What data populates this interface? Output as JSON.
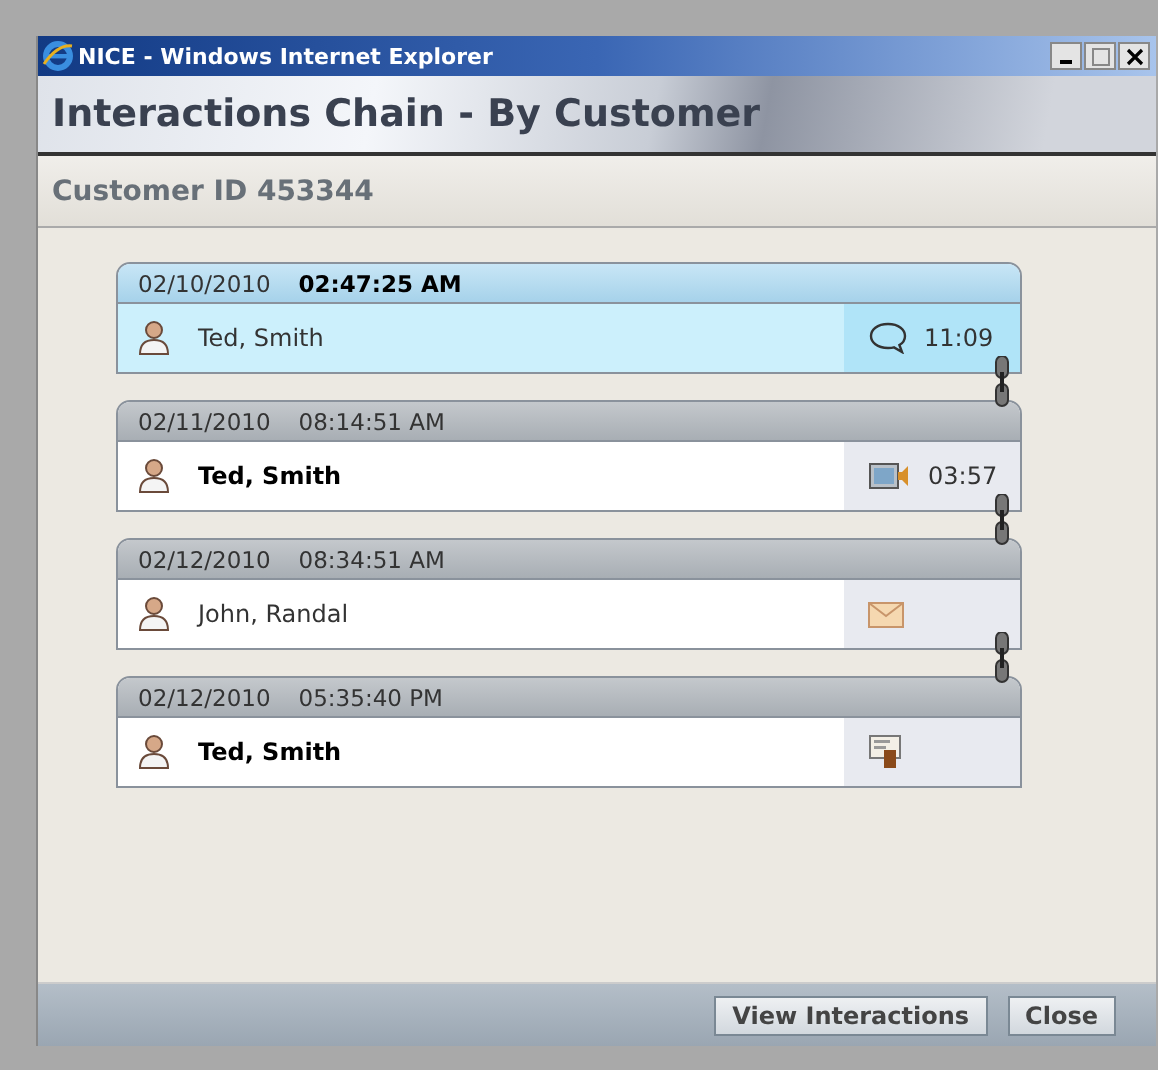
{
  "window": {
    "title": "NICE - Windows Internet Explorer"
  },
  "header": {
    "title": "Interactions Chain - By Customer"
  },
  "customer": {
    "label": "Customer ID 453344"
  },
  "interactions": [
    {
      "date": "02/10/2010",
      "time": "02:47:25 AM",
      "selected": true,
      "name": "Ted, Smith",
      "unread": false,
      "kind": "chat",
      "duration": "11:09"
    },
    {
      "date": "02/11/2010",
      "time": "08:14:51 AM",
      "selected": false,
      "name": "Ted, Smith",
      "unread": true,
      "kind": "video",
      "duration": "03:57"
    },
    {
      "date": "02/12/2010",
      "time": "08:34:51 AM",
      "selected": false,
      "name": "John, Randal",
      "unread": false,
      "kind": "email"
    },
    {
      "date": "02/12/2010",
      "time": "05:35:40 PM",
      "selected": false,
      "name": "Ted, Smith",
      "unread": true,
      "kind": "document"
    }
  ],
  "buttons": [
    {
      "label": "View Interactions"
    },
    {
      "label": "Close"
    }
  ]
}
